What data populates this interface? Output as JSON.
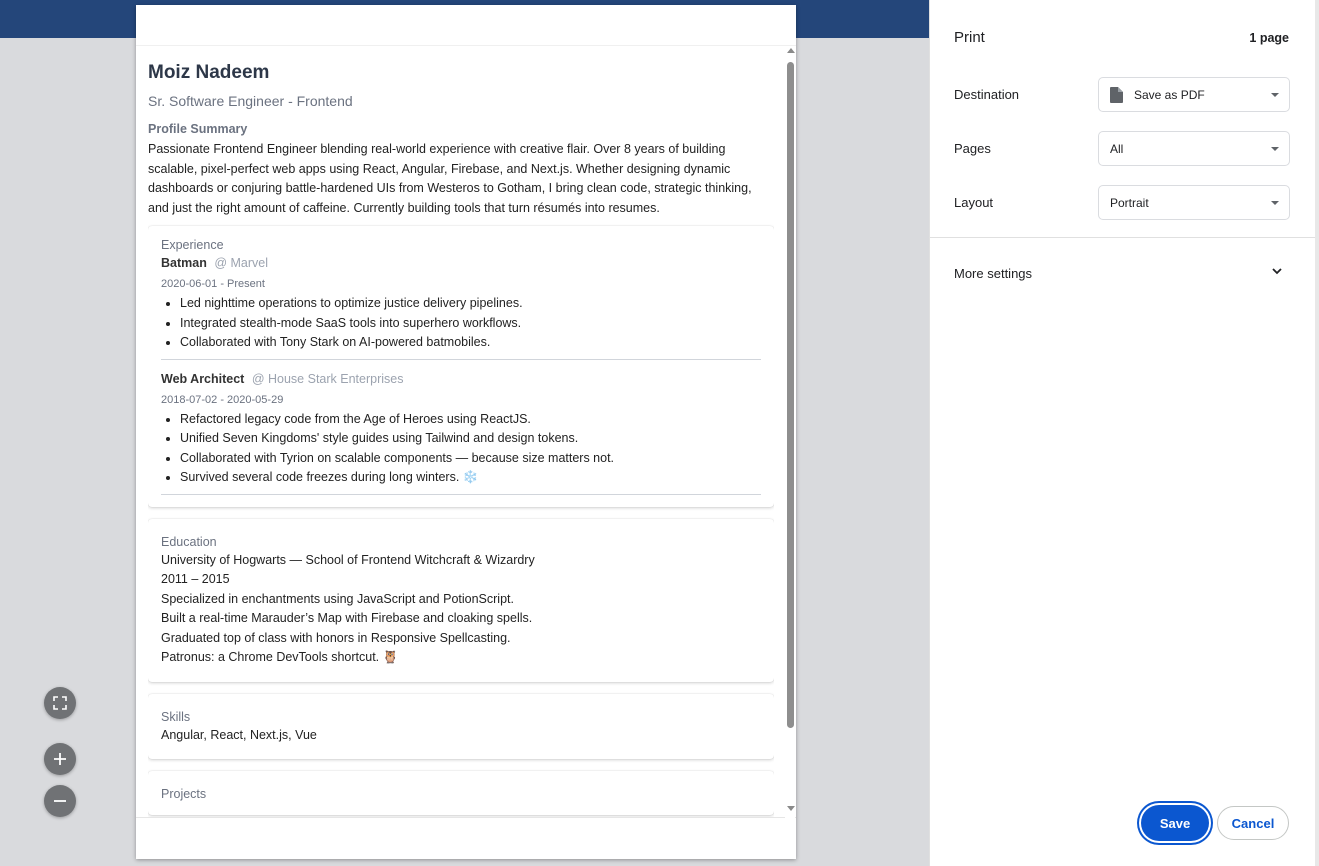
{
  "resume": {
    "name": "Moiz Nadeem",
    "title": "Sr. Software Engineer - Frontend",
    "summary_label": "Profile Summary",
    "summary": "Passionate Frontend Engineer blending real-world experience with creative flair. Over 8 years of building scalable, pixel-perfect web apps using React, Angular, Firebase, and Next.js. Whether designing dynamic dashboards or conjuring battle-hardened UIs from Westeros to Gotham, I bring clean code, strategic thinking, and just the right amount of caffeine. Currently building tools that turn résumés into resumes.",
    "experience": {
      "label": "Experience",
      "jobs": [
        {
          "role": "Batman",
          "company": "@ Marvel",
          "dates": "2020-06-01 - Present",
          "bullets": [
            "Led nighttime operations to optimize justice delivery pipelines.",
            "Integrated stealth-mode SaaS tools into superhero workflows.",
            "Collaborated with Tony Stark on AI-powered batmobiles."
          ]
        },
        {
          "role": "Web Architect",
          "company": "@ House Stark Enterprises",
          "dates": "2018-07-02 - 2020-05-29",
          "bullets": [
            "Refactored legacy code from the Age of Heroes using ReactJS.",
            "Unified Seven Kingdoms' style guides using Tailwind and design tokens.",
            "Collaborated with Tyrion on scalable components — because size matters not.",
            "Survived several code freezes during long winters. ❄️"
          ]
        }
      ]
    },
    "education": {
      "label": "Education",
      "lines": [
        "University of Hogwarts — School of Frontend Witchcraft & Wizardry",
        "2011 – 2015",
        "Specialized in enchantments using JavaScript and PotionScript.",
        "Built a real-time Marauder’s Map with Firebase and cloaking spells.",
        "Graduated top of class with honors in Responsive Spellcasting.",
        "Patronus: a Chrome DevTools shortcut. 🦉"
      ]
    },
    "skills": {
      "label": "Skills",
      "text": "Angular, React, Next.js, Vue"
    },
    "projects": {
      "label": "Projects"
    }
  },
  "print_panel": {
    "title": "Print",
    "page_count": "1 page",
    "destination_label": "Destination",
    "destination_value": "Save as PDF",
    "pages_label": "Pages",
    "pages_value": "All",
    "layout_label": "Layout",
    "layout_value": "Portrait",
    "more_settings": "More settings",
    "save": "Save",
    "cancel": "Cancel"
  },
  "colors": {
    "accent": "#0b57d0",
    "background": "#d9dadd"
  },
  "icons": {
    "fit": "fit-to-page-icon",
    "zoom_in": "zoom-in-icon",
    "zoom_out": "zoom-out-icon",
    "pdf": "document-icon",
    "chevron": "chevron-down-icon"
  }
}
